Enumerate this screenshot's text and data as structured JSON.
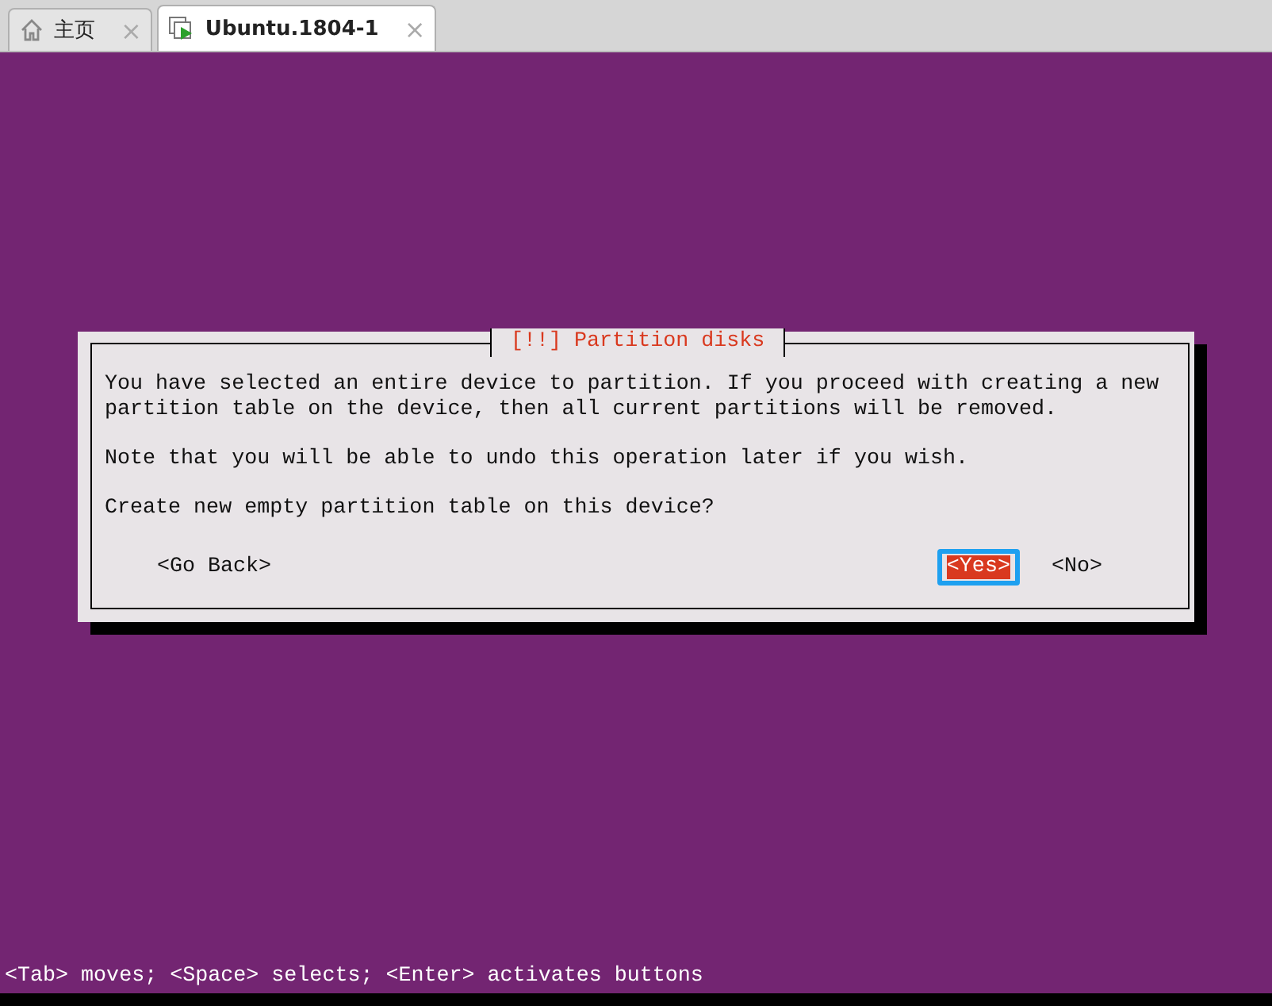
{
  "tabs": [
    {
      "label": "主页",
      "kind": "home",
      "selected": false,
      "close": "×"
    },
    {
      "label": "Ubuntu.1804-1",
      "kind": "vm",
      "selected": true,
      "close": "×"
    }
  ],
  "dialog": {
    "title": "[!!] Partition disks",
    "paragraphs": [
      "You have selected an entire device to partition. If you proceed with creating a new partition table on the device, then all current partitions will be removed.",
      "Note that you will be able to undo this operation later if you wish.",
      "Create new empty partition table on this device?"
    ],
    "buttons": [
      {
        "label": "<Go Back>",
        "selected": false
      },
      {
        "label": "<Yes>",
        "selected": true
      },
      {
        "label": "<No>",
        "selected": false
      }
    ]
  },
  "status_bar": "<Tab> moves; <Space> selects; <Enter> activates buttons"
}
